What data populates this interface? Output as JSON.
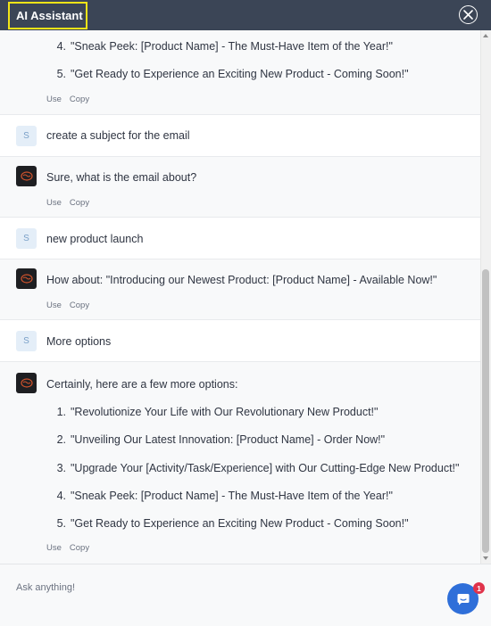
{
  "header": {
    "title": "AI Assistant"
  },
  "user_initial": "S",
  "action_labels": {
    "use": "Use",
    "copy": "Copy"
  },
  "top_partial": {
    "options": [
      {
        "num": "4.",
        "text": "\"Sneak Peek: [Product Name] - The Must-Have Item of the Year!\""
      },
      {
        "num": "5.",
        "text": "\"Get Ready to Experience an Exciting New Product - Coming Soon!\""
      }
    ]
  },
  "messages": {
    "user1": "create a subject for the email",
    "bot1": "Sure, what is the email about?",
    "user2": "new product launch",
    "bot2": "How about: \"Introducing our Newest Product: [Product Name] - Available Now!\"",
    "user3": "More options",
    "bot3_intro": "Certainly, here are a few more options:",
    "bot3_options": [
      {
        "num": "1.",
        "text": "\"Revolutionize Your Life with Our Revolutionary New Product!\""
      },
      {
        "num": "2.",
        "text": "\"Unveiling Our Latest Innovation: [Product Name] - Order Now!\""
      },
      {
        "num": "3.",
        "text": "\"Upgrade Your [Activity/Task/Experience] with Our Cutting-Edge New Product!\""
      },
      {
        "num": "4.",
        "text": "\"Sneak Peek: [Product Name] - The Must-Have Item of the Year!\""
      },
      {
        "num": "5.",
        "text": "\"Get Ready to Experience an Exciting New Product - Coming Soon!\""
      }
    ]
  },
  "input": {
    "placeholder": "Ask anything!",
    "value": ""
  },
  "launcher": {
    "badge_count": "1"
  },
  "colors": {
    "header_bg": "#3b4556",
    "highlight": "#f2e418",
    "accent": "#2f6fd9",
    "badge": "#e0334b"
  }
}
